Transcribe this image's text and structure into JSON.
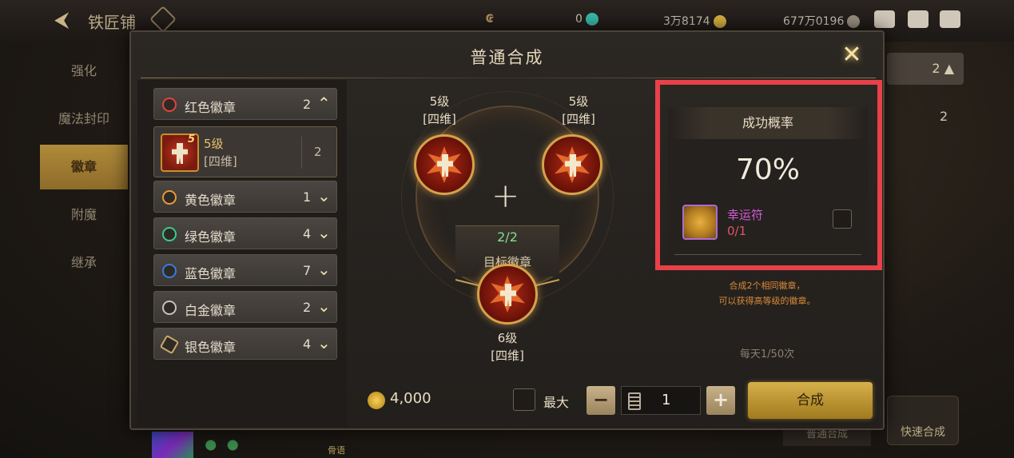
{
  "topbar": {
    "back_icon": "back-arrow-icon",
    "title": "铁匠铺",
    "currency_1": "0",
    "currency_2": "3万8174",
    "currency_3": "677万0196"
  },
  "left_menu": {
    "items": [
      {
        "label": "强化"
      },
      {
        "label": "魔法封印"
      },
      {
        "label": "徽章"
      },
      {
        "label": "附魔"
      },
      {
        "label": "继承"
      }
    ],
    "active_index": 2
  },
  "background_right": {
    "chip_count": "2",
    "row_count": "2",
    "quick_button": "快速合成",
    "bottom_button": "普通合成"
  },
  "background_bottom": {
    "item_text": "骨语"
  },
  "dialog": {
    "title": "普通合成",
    "close_icon": "close-icon"
  },
  "badge_list": {
    "categories": [
      {
        "label": "红色徽章",
        "count": "2",
        "color": "#e0443a",
        "expanded": true
      },
      {
        "label": "黄色徽章",
        "count": "1",
        "color": "#e89a3a",
        "expanded": false
      },
      {
        "label": "绿色徽章",
        "count": "4",
        "color": "#3acb8a",
        "expanded": false
      },
      {
        "label": "蓝色徽章",
        "count": "7",
        "color": "#3a7ae0",
        "expanded": false
      },
      {
        "label": "白金徽章",
        "count": "2",
        "color": "#c8c2b8",
        "expanded": false
      },
      {
        "label": "银色徽章",
        "count": "4",
        "color": "#c8a86a",
        "expanded": false
      }
    ],
    "selected_badge": {
      "level": "5级",
      "type": "[四维]",
      "count": "2",
      "thumb_level": "5"
    }
  },
  "synthesis": {
    "left_material": {
      "level": "5级",
      "type": "[四维]"
    },
    "right_material": {
      "level": "5级",
      "type": "[四维]"
    },
    "target_progress": "2/2",
    "target_label": "目标徽章",
    "result": {
      "level": "6级",
      "type": "[四维]"
    }
  },
  "success": {
    "header": "成功概率",
    "value": "70%",
    "charm_name": "幸运符",
    "charm_count": "0/1",
    "charm_checked": false
  },
  "description": {
    "line1": "合成2个相同徽章，",
    "line2": "可以获得高等级的徽章。",
    "daily_limit": "每天1/50次"
  },
  "bottom": {
    "cost": "4,000",
    "max_label": "最大",
    "quantity": "1",
    "synth_button": "合成"
  },
  "colors": {
    "highlight": "#e8414a",
    "gold_button": "#c89a32",
    "green_progress": "#7fe08a",
    "charm_name": "#d45ad8",
    "charm_count": "#e0556a"
  }
}
